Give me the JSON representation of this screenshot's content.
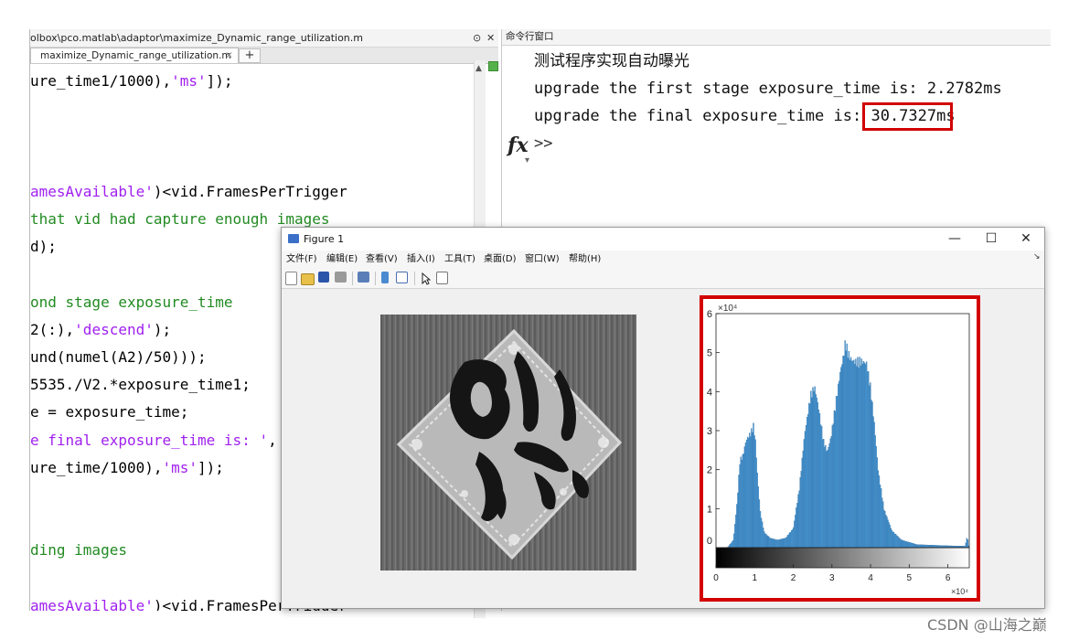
{
  "editor": {
    "path": "olbox\\pco.matlab\\adaptor\\maximize_Dynamic_range_utilization.m",
    "tab_label": "maximize_Dynamic_range_utilization.m",
    "tab_close": "✕",
    "tab_add": "+",
    "lines": [
      {
        "parts": [
          {
            "t": "ure_time1/1000),",
            "c": "k"
          },
          {
            "t": "'ms'",
            "c": "s"
          },
          {
            "t": "]);",
            "c": "k"
          }
        ]
      },
      {
        "parts": []
      },
      {
        "parts": []
      },
      {
        "parts": []
      },
      {
        "parts": [
          {
            "t": "amesAvailable'",
            "c": "s"
          },
          {
            "t": ")<vid.FramesPerTrigger",
            "c": "k"
          }
        ]
      },
      {
        "parts": [
          {
            "t": "that vid had capture enough images",
            "c": "g"
          }
        ]
      },
      {
        "parts": [
          {
            "t": "d);",
            "c": "k"
          }
        ]
      },
      {
        "parts": []
      },
      {
        "parts": [
          {
            "t": "ond stage exposure_time",
            "c": "g"
          }
        ]
      },
      {
        "parts": [
          {
            "t": "2(:),",
            "c": "k"
          },
          {
            "t": "'descend'",
            "c": "s"
          },
          {
            "t": ");",
            "c": "k"
          }
        ]
      },
      {
        "parts": [
          {
            "t": "und(numel(A2)/50)));",
            "c": "k"
          }
        ]
      },
      {
        "parts": [
          {
            "t": "5535./V2.*exposure_time1;",
            "c": "k"
          }
        ]
      },
      {
        "parts": [
          {
            "t": "e = exposure_time;",
            "c": "k"
          }
        ]
      },
      {
        "parts": [
          {
            "t": "e final exposure_time is: '",
            "c": "s"
          },
          {
            "t": ",",
            "c": "k"
          }
        ]
      },
      {
        "parts": [
          {
            "t": "ure_time/1000),",
            "c": "k"
          },
          {
            "t": "'ms'",
            "c": "s"
          },
          {
            "t": "]);",
            "c": "k"
          }
        ]
      },
      {
        "parts": []
      },
      {
        "parts": []
      },
      {
        "parts": [
          {
            "t": "ding images",
            "c": "g"
          }
        ]
      },
      {
        "parts": []
      },
      {
        "parts": [
          {
            "t": "amesAvailable'",
            "c": "s"
          },
          {
            "t": ")<vid.FramesPerTrigger",
            "c": "k"
          }
        ]
      }
    ]
  },
  "command_window": {
    "title": "命令行窗口",
    "line1": "测试程序实现自动曝光",
    "line2": "upgrade the first stage exposure_time is: 2.2782ms",
    "line3_prefix": "upgrade the final exposure_time is: ",
    "line3_value": "30.7327ms",
    "fx_label": "fx",
    "prompt": ">>"
  },
  "figure": {
    "title": "Figure 1",
    "menu": [
      "文件(F)",
      "编辑(E)",
      "查看(V)",
      "插入(I)",
      "工具(T)",
      "桌面(D)",
      "窗口(W)",
      "帮助(H)"
    ],
    "toolbar_icons": [
      "new-figure-icon",
      "open-file-icon",
      "save-icon",
      "print-icon",
      "link-icon",
      "colorbar-icon",
      "legend-icon",
      "pointer-icon",
      "property-inspector-icon"
    ],
    "window_buttons": {
      "minimize": "—",
      "maximize": "☐",
      "close": "✕"
    }
  },
  "chart_data": {
    "type": "bar",
    "title": "",
    "xlabel": "",
    "ylabel": "",
    "x_exponent": "×10⁴",
    "y_exponent": "×10⁴",
    "xlim": [
      0,
      6.5536
    ],
    "ylim": [
      0,
      6
    ],
    "x_ticks": [
      0,
      1,
      2,
      3,
      4,
      5,
      6
    ],
    "y_ticks": [
      0,
      1,
      2,
      3,
      4,
      5,
      6
    ],
    "bar_color": "#4b9ad6",
    "colorbar": "gray",
    "profile": [
      [
        0.0,
        0.0
      ],
      [
        0.3,
        0.0
      ],
      [
        0.45,
        0.2
      ],
      [
        0.55,
        1.2
      ],
      [
        0.62,
        2.3
      ],
      [
        0.7,
        2.4
      ],
      [
        0.78,
        2.8
      ],
      [
        0.9,
        3.0
      ],
      [
        0.97,
        3.2
      ],
      [
        1.02,
        2.8
      ],
      [
        1.08,
        1.8
      ],
      [
        1.15,
        0.9
      ],
      [
        1.25,
        0.4
      ],
      [
        1.4,
        0.25
      ],
      [
        1.6,
        0.2
      ],
      [
        1.8,
        0.25
      ],
      [
        2.0,
        0.5
      ],
      [
        2.15,
        1.5
      ],
      [
        2.3,
        3.0
      ],
      [
        2.45,
        4.0
      ],
      [
        2.55,
        4.2
      ],
      [
        2.65,
        3.7
      ],
      [
        2.78,
        2.8
      ],
      [
        2.88,
        2.5
      ],
      [
        2.98,
        2.9
      ],
      [
        3.1,
        3.8
      ],
      [
        3.22,
        4.6
      ],
      [
        3.3,
        5.0
      ],
      [
        3.35,
        5.4
      ],
      [
        3.42,
        5.1
      ],
      [
        3.5,
        4.9
      ],
      [
        3.6,
        4.85
      ],
      [
        3.7,
        4.9
      ],
      [
        3.8,
        4.85
      ],
      [
        3.9,
        4.8
      ],
      [
        4.0,
        4.2
      ],
      [
        4.1,
        3.2
      ],
      [
        4.2,
        2.0
      ],
      [
        4.35,
        1.0
      ],
      [
        4.55,
        0.45
      ],
      [
        4.8,
        0.2
      ],
      [
        5.2,
        0.08
      ],
      [
        6.0,
        0.05
      ],
      [
        6.45,
        0.04
      ],
      [
        6.5,
        0.3
      ],
      [
        6.55,
        0.0
      ]
    ]
  },
  "watermark": "CSDN @山海之巅"
}
